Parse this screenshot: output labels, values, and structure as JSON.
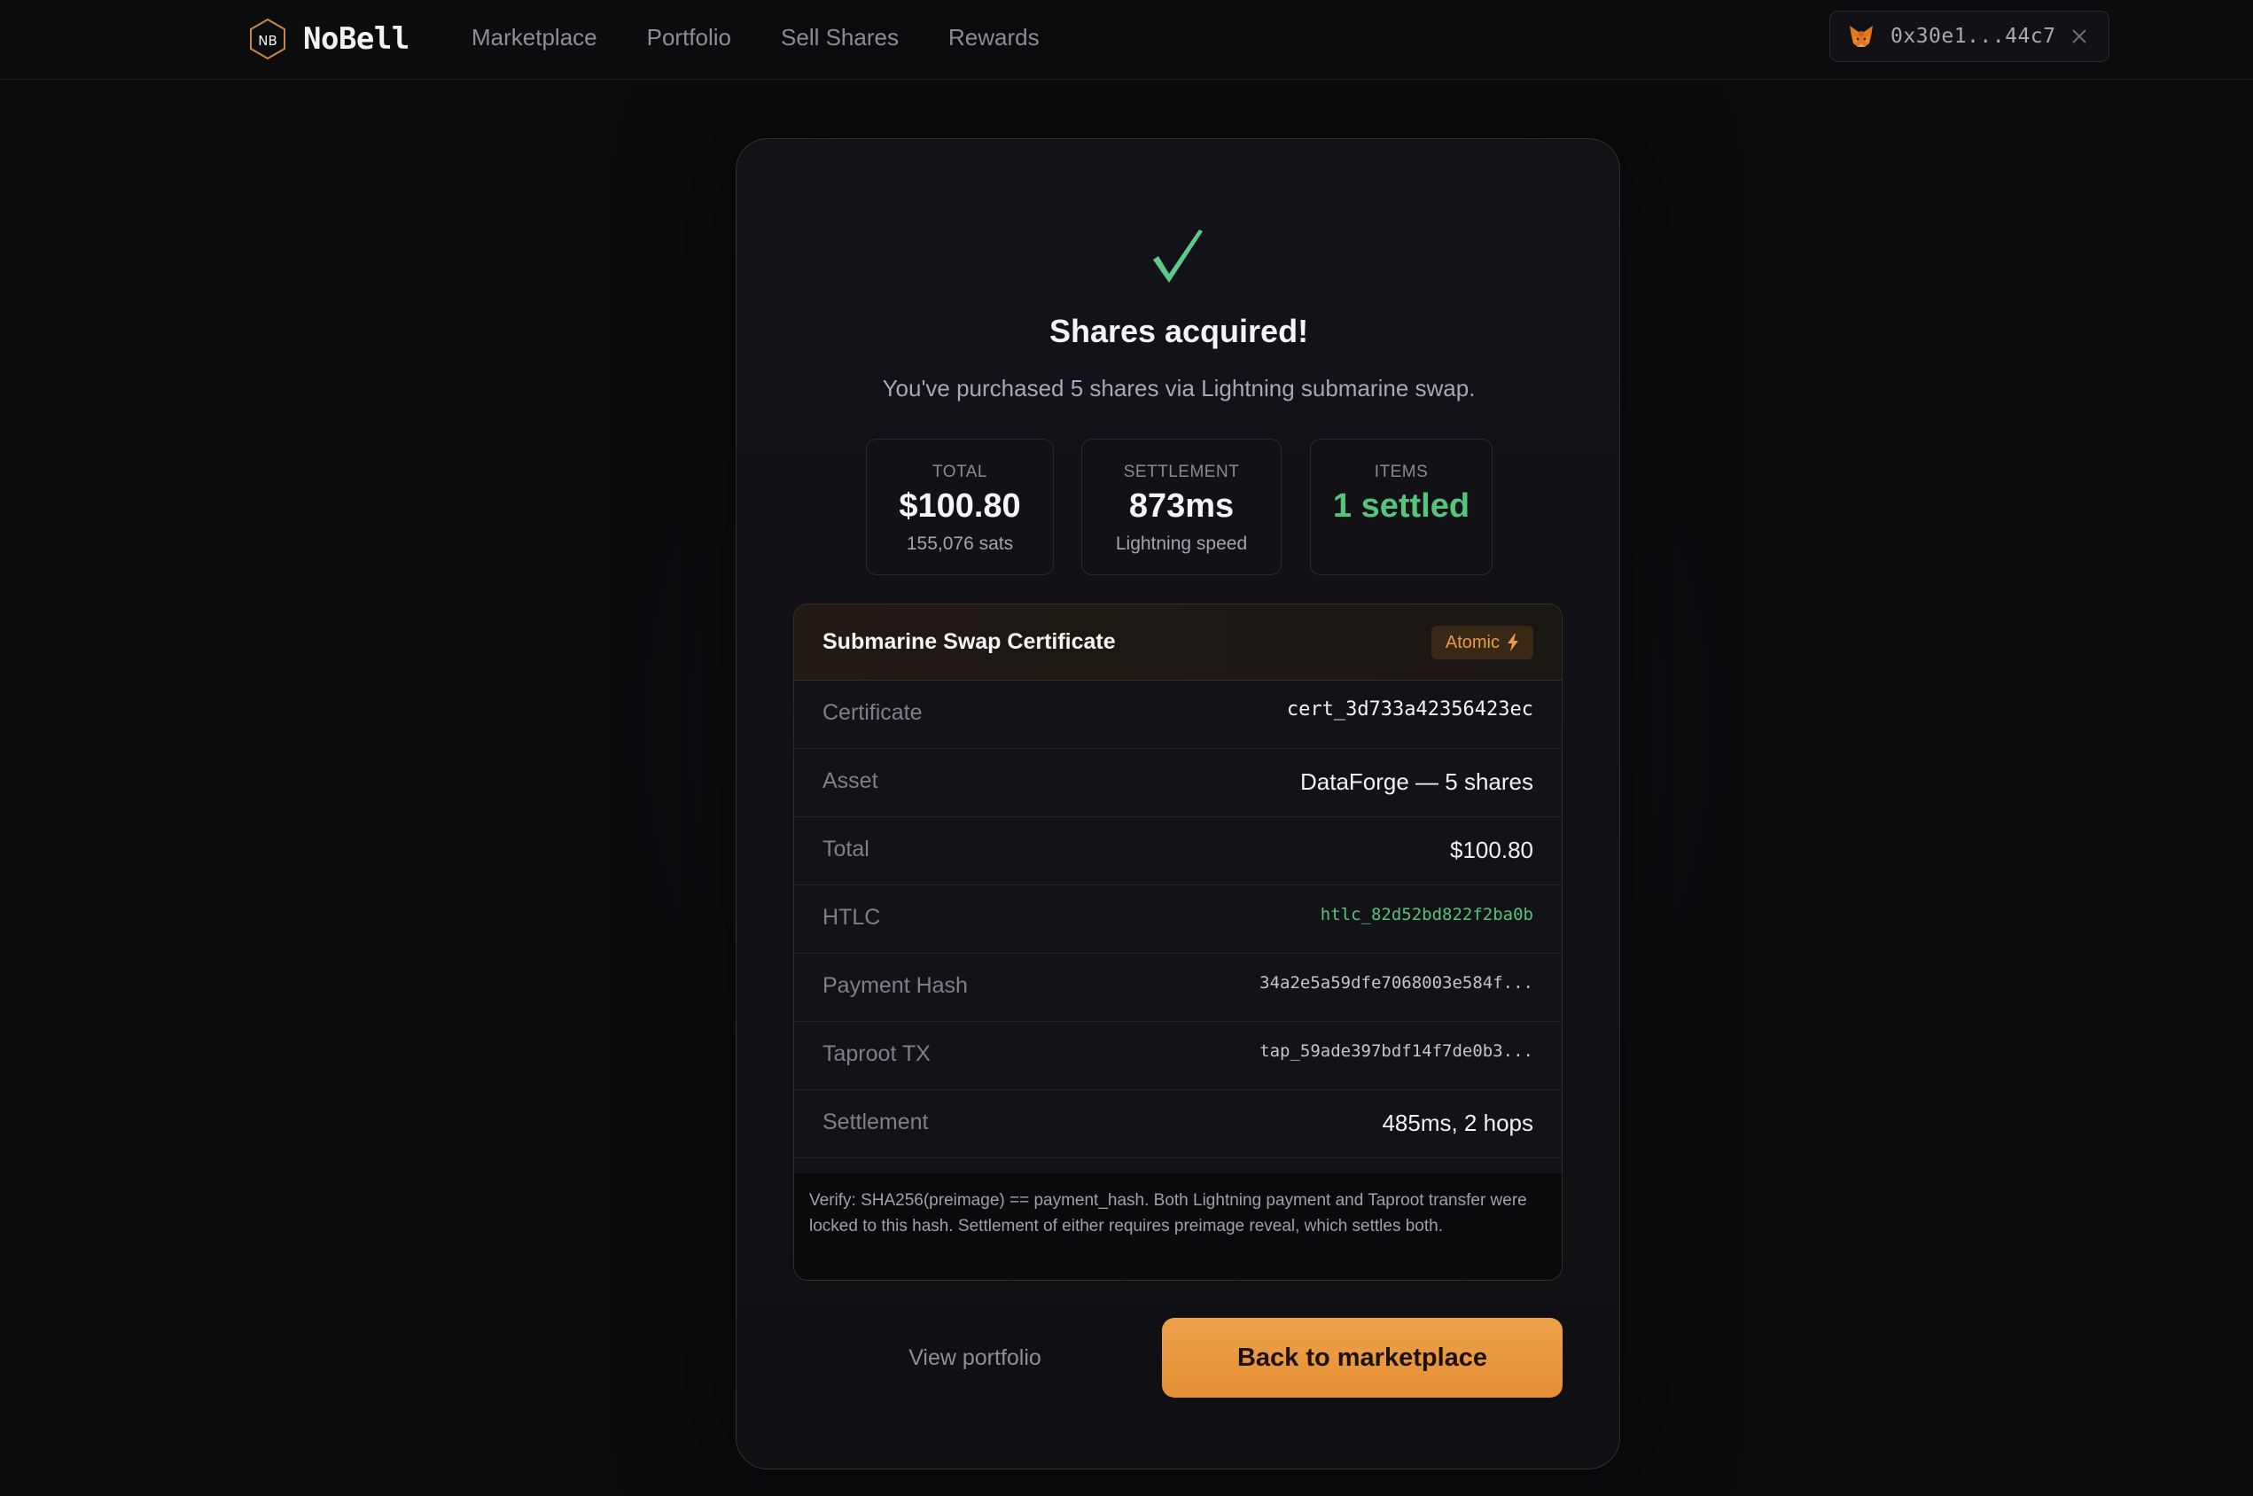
{
  "app": {
    "logo_text": "NB",
    "name": "NoBell"
  },
  "nav": {
    "items": [
      "Marketplace",
      "Portfolio",
      "Sell Shares",
      "Rewards"
    ]
  },
  "wallet": {
    "icon": "metamask-fox-icon",
    "address": "0x30e1...44c7"
  },
  "result": {
    "title": "Shares acquired!",
    "subtitle": "You've purchased 5 shares via Lightning submarine swap.",
    "stats": [
      {
        "label": "TOTAL",
        "value": "$100.80",
        "note": "155,076 sats"
      },
      {
        "label": "SETTLEMENT",
        "value": "873ms",
        "note": "Lightning speed"
      },
      {
        "label": "ITEMS",
        "value": "1 settled",
        "note": ""
      }
    ]
  },
  "certificate": {
    "title": "Submarine Swap Certificate",
    "badge": "Atomic",
    "rows": [
      {
        "label": "Certificate",
        "value": "cert_3d733a42356423ec"
      },
      {
        "label": "Asset",
        "value": "DataForge — 5 shares"
      },
      {
        "label": "Total",
        "value": "$100.80"
      },
      {
        "label": "HTLC",
        "value": "htlc_82d52bd822f2ba0b"
      },
      {
        "label": "Payment Hash",
        "value": "34a2e5a59dfe7068003e584f..."
      },
      {
        "label": "Taproot TX",
        "value": "tap_59ade397bdf14f7de0b3..."
      },
      {
        "label": "Settlement",
        "value": "485ms, 2 hops"
      }
    ],
    "verify_note": "Verify: SHA256(preimage) == payment_hash. Both Lightning payment and Taproot transfer were locked to this hash. Settlement of either requires preimage reveal, which settles both."
  },
  "actions": {
    "secondary": "View portfolio",
    "primary": "Back to marketplace"
  },
  "colors": {
    "accent": "#e8953a",
    "success": "#56c47a",
    "background": "#0b0b0e"
  }
}
